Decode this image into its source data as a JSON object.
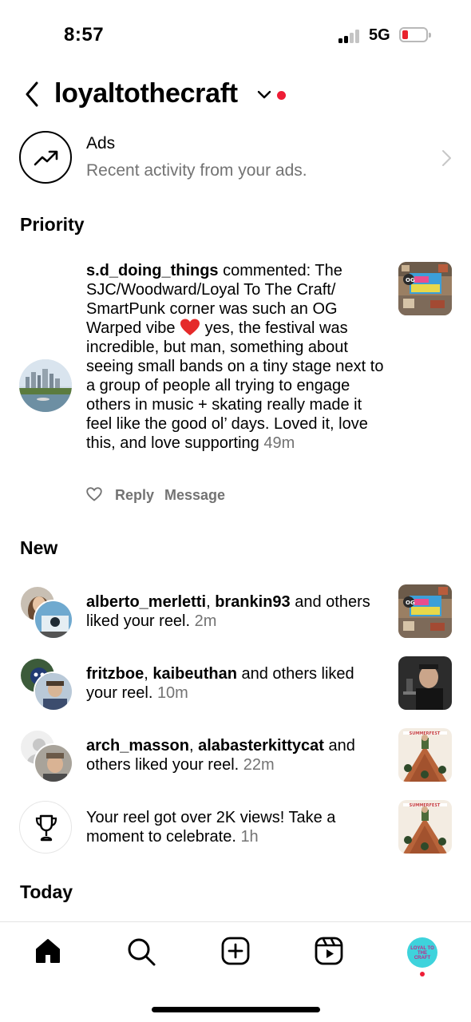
{
  "status_bar": {
    "time": "8:57",
    "network": "5G"
  },
  "header": {
    "account": "loyaltothecraft"
  },
  "ads": {
    "title": "Ads",
    "subtitle": "Recent activity from your ads."
  },
  "sections": {
    "priority": "Priority",
    "new": "New",
    "today": "Today"
  },
  "priority_item": {
    "username": "s.d_doing_things",
    "text_before_emoji": " commented: The SJC/Woodward/Loyal To The Craft/ SmartPunk corner was such an OG Warped vibe ",
    "emoji": "red-heart",
    "text_after_emoji": " yes, the festival was incredible, but man, something about seeing small bands on a tiny stage next to a group of people all trying to engage others in music + skating really made it feel like the good ol’ days. Loved it, love this, and love supporting",
    "time": "49m",
    "actions": {
      "reply": "Reply",
      "message": "Message"
    }
  },
  "notifications": [
    {
      "user1": "alberto_merletti",
      "sep": ", ",
      "user2": "brankin93",
      "text": " and others liked your reel.",
      "time": "2m"
    },
    {
      "user1": "fritzboe",
      "sep": ", ",
      "user2": "kaibeuthan",
      "text": " and others liked your reel.",
      "time": "10m"
    },
    {
      "user1": "arch_masson",
      "sep": ", ",
      "user2": "alabasterkittycat",
      "text": " and others liked your reel.",
      "time": "22m"
    },
    {
      "text": "Your reel got over 2K views! Take a moment to celebrate.",
      "time": "1h"
    }
  ],
  "thumb_labels": {
    "og": "OG",
    "summerfest": "SUMMERFEST"
  },
  "profile_avatar_text": "LOYAL TO THE CRAFT",
  "colors": {
    "notification_dot": "#ee1d36",
    "muted_text": "#737373",
    "battery_low": "#e8232e"
  }
}
